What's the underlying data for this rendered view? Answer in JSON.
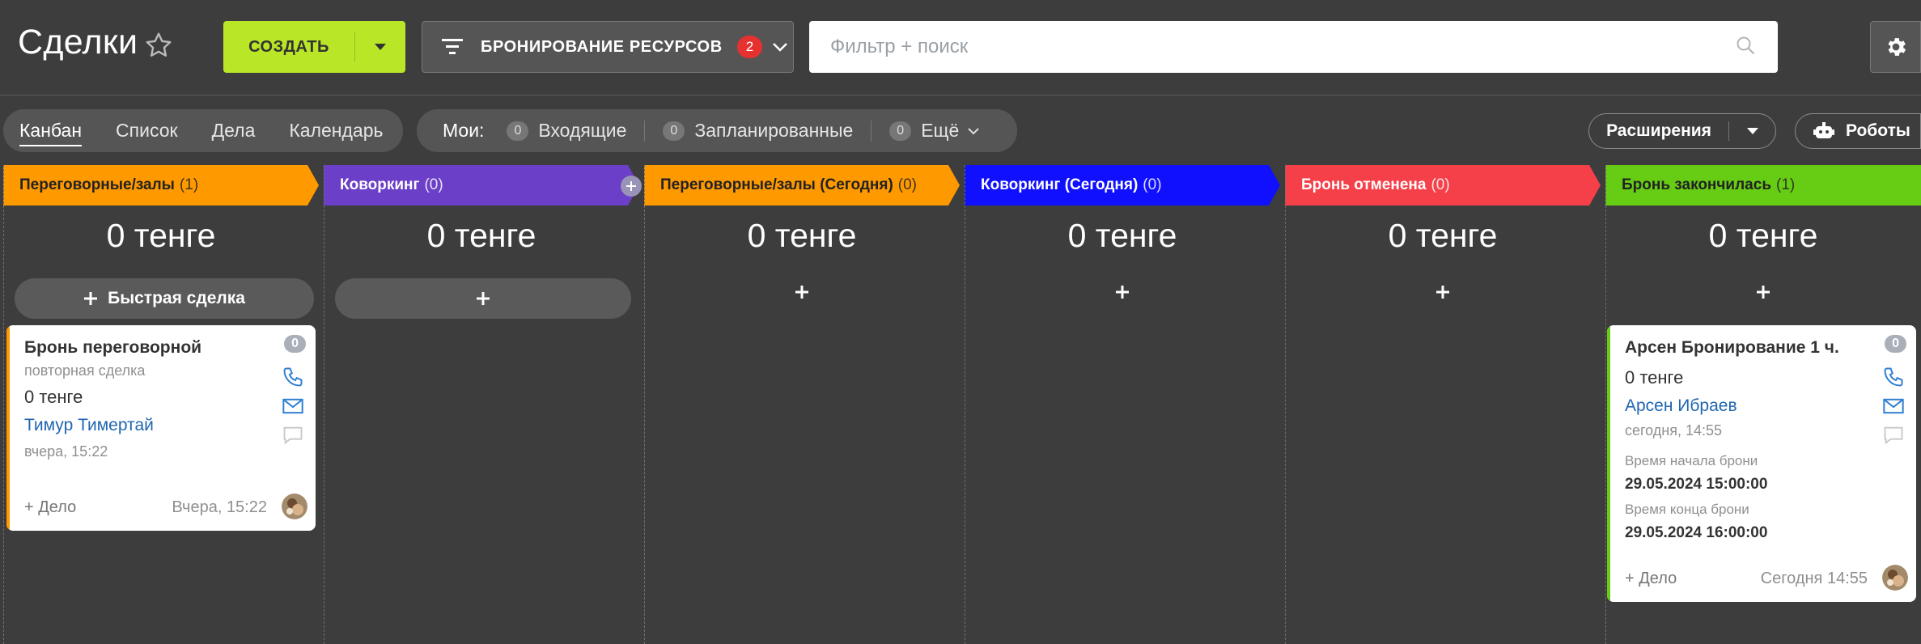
{
  "header": {
    "title": "Сделки",
    "create_label": "СОЗДАТЬ",
    "preset_label": "БРОНИРОВАНИЕ РЕСУРСОВ",
    "preset_count": "2",
    "search_placeholder": "Фильтр + поиск"
  },
  "views": [
    {
      "label": "Канбан",
      "active": true
    },
    {
      "label": "Список"
    },
    {
      "label": "Дела"
    },
    {
      "label": "Календарь"
    }
  ],
  "counters": {
    "mine_label": "Мои:",
    "incoming": {
      "count": "0",
      "label": "Входящие"
    },
    "planned": {
      "count": "0",
      "label": "Запланированные"
    },
    "more": {
      "count": "0",
      "label": "Ещё"
    }
  },
  "extensions_label": "Расширения",
  "robots_label": "Роботы",
  "columns": [
    {
      "name": "Переговорные/залы",
      "count": "(1)",
      "color": "#ff9900",
      "text_color": "#222",
      "sum": "0 тенге",
      "add": "Быстрая сделка"
    },
    {
      "name": "Коворкинг",
      "count": "(0)",
      "color": "#6b3fc7",
      "text_color": "#fff",
      "sum": "0 тенге",
      "add": "+"
    },
    {
      "name": "Переговорные/залы (Сегодня)",
      "count": "(0)",
      "color": "#ff9900",
      "text_color": "#222",
      "sum": "0 тенге",
      "add": "+"
    },
    {
      "name": "Коворкинг (Сегодня)",
      "count": "(0)",
      "color": "#1010ff",
      "text_color": "#fff",
      "sum": "0 тенге",
      "add": "+"
    },
    {
      "name": "Бронь отменена",
      "count": "(0)",
      "color": "#f5404a",
      "text_color": "#fff",
      "sum": "0 тенге",
      "add": "+"
    },
    {
      "name": "Бронь закончилась",
      "count": "(1)",
      "color": "#66cc14",
      "text_color": "#222",
      "sum": "0 тенге",
      "add": "+"
    }
  ],
  "cards": {
    "card1": {
      "title": "Бронь переговорной",
      "subtitle": "повторная сделка",
      "amount": "0 тенге",
      "contact": "Тимур Тимертай",
      "time": "вчера, 15:22",
      "badge": "0",
      "add_task": "+ Дело",
      "date": "Вчера, 15:22",
      "stripe_color": "#ff9900"
    },
    "card2": {
      "title": "Арсен Бронирование 1 ч.",
      "amount": "0 тенге",
      "contact": "Арсен Ибраев",
      "time": "сегодня, 14:55",
      "start_label": "Время начала брони",
      "start_value": "29.05.2024 15:00:00",
      "end_label": "Время конца брони",
      "end_value": "29.05.2024 16:00:00",
      "badge": "0",
      "add_task": "+ Дело",
      "date": "Сегодня 14:55",
      "stripe_color": "#66cc14"
    }
  }
}
